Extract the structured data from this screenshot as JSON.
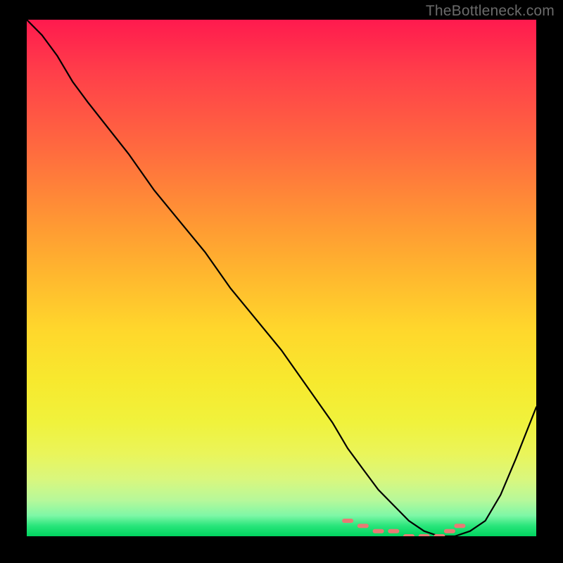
{
  "attribution": "TheBottleneck.com",
  "chart_data": {
    "type": "line",
    "title": "",
    "xlabel": "",
    "ylabel": "",
    "x": [
      0.0,
      0.03,
      0.06,
      0.09,
      0.12,
      0.16,
      0.2,
      0.25,
      0.3,
      0.35,
      0.4,
      0.45,
      0.5,
      0.55,
      0.6,
      0.63,
      0.66,
      0.69,
      0.72,
      0.75,
      0.78,
      0.81,
      0.84,
      0.87,
      0.9,
      0.93,
      0.96,
      1.0
    ],
    "values": [
      100,
      97,
      93,
      88,
      84,
      79,
      74,
      67,
      61,
      55,
      48,
      42,
      36,
      29,
      22,
      17,
      13,
      9,
      6,
      3,
      1,
      0,
      0,
      1,
      3,
      8,
      15,
      25
    ],
    "ylim": [
      0,
      100
    ],
    "xlim": [
      0,
      1
    ],
    "markers": {
      "x": [
        0.63,
        0.66,
        0.69,
        0.72,
        0.75,
        0.78,
        0.81,
        0.83,
        0.85
      ],
      "values": [
        3,
        2,
        1,
        1,
        0,
        0,
        0,
        1,
        2
      ]
    },
    "gradient_stops": [
      {
        "pos": 0.0,
        "color": "#ff1a4e"
      },
      {
        "pos": 0.1,
        "color": "#ff3e4a"
      },
      {
        "pos": 0.25,
        "color": "#ff6a3f"
      },
      {
        "pos": 0.4,
        "color": "#ff9a33"
      },
      {
        "pos": 0.5,
        "color": "#ffb92e"
      },
      {
        "pos": 0.6,
        "color": "#ffd72c"
      },
      {
        "pos": 0.7,
        "color": "#f7e92e"
      },
      {
        "pos": 0.78,
        "color": "#f0f23c"
      },
      {
        "pos": 0.84,
        "color": "#eaf55a"
      },
      {
        "pos": 0.89,
        "color": "#d9f77e"
      },
      {
        "pos": 0.93,
        "color": "#b7f89a"
      },
      {
        "pos": 0.96,
        "color": "#7ef7a6"
      },
      {
        "pos": 0.98,
        "color": "#28e57a"
      },
      {
        "pos": 1.0,
        "color": "#00d45f"
      }
    ]
  }
}
